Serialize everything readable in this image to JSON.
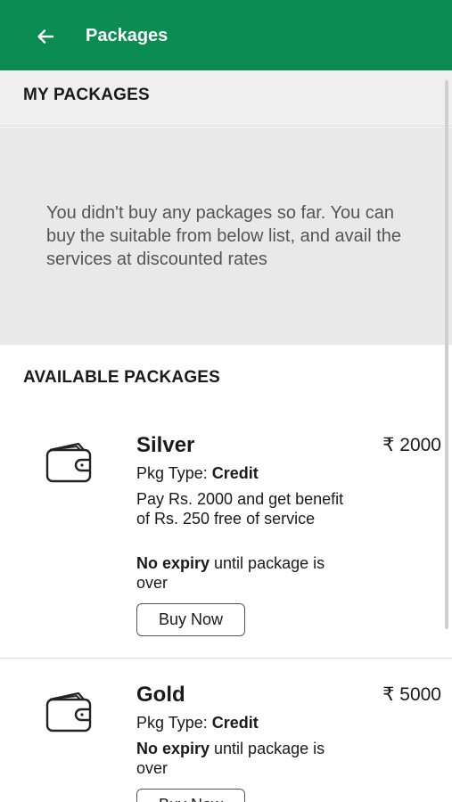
{
  "header": {
    "title": "Packages",
    "back_icon": "arrow-left-icon",
    "color": "#0b8d52"
  },
  "my_packages": {
    "title": "MY PACKAGES",
    "empty_message": "You didn't buy any packages so far. You can buy the suitable from below list, and avail the services at discounted rates"
  },
  "available": {
    "title": "AVAILABLE PACKAGES",
    "packages": [
      {
        "name": "Silver",
        "price": "₹ 2000",
        "type_label": "Pkg Type: ",
        "type_value": "Credit",
        "description": "Pay Rs. 2000 and get benefit of Rs. 250 free of service",
        "expiry_bold": "No expiry",
        "expiry_rest": " until package is over",
        "buy_label": "Buy Now",
        "icon": "wallet-icon"
      },
      {
        "name": "Gold",
        "price": "₹ 5000",
        "type_label": "Pkg Type: ",
        "type_value": "Credit",
        "expiry_bold": "No expiry",
        "expiry_rest": " until package is over",
        "buy_label": "Buy Now",
        "icon": "wallet-icon"
      }
    ]
  }
}
